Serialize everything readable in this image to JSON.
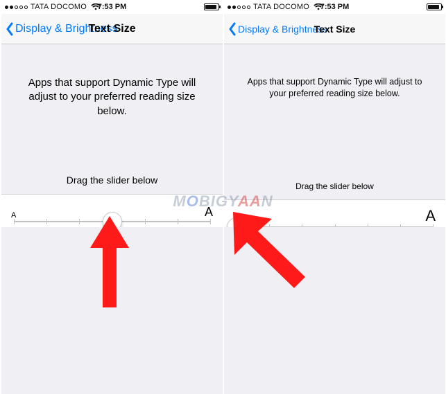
{
  "status": {
    "carrier": "TATA DOCOMO",
    "time": "7:53 PM"
  },
  "nav": {
    "back_label": "Display & Brightness",
    "title": "Text Size"
  },
  "body": {
    "description": "Apps that support Dynamic Type will adjust to your preferred reading size below.",
    "instruction": "Drag the slider below",
    "min_glyph": "A",
    "max_glyph": "A"
  },
  "slider": {
    "ticks": 7,
    "left_index": 3,
    "right_index": 0
  },
  "watermark": {
    "pre": "M",
    "mid": "O",
    "post": "BIGY",
    "aa": "AA",
    "end": "N"
  }
}
